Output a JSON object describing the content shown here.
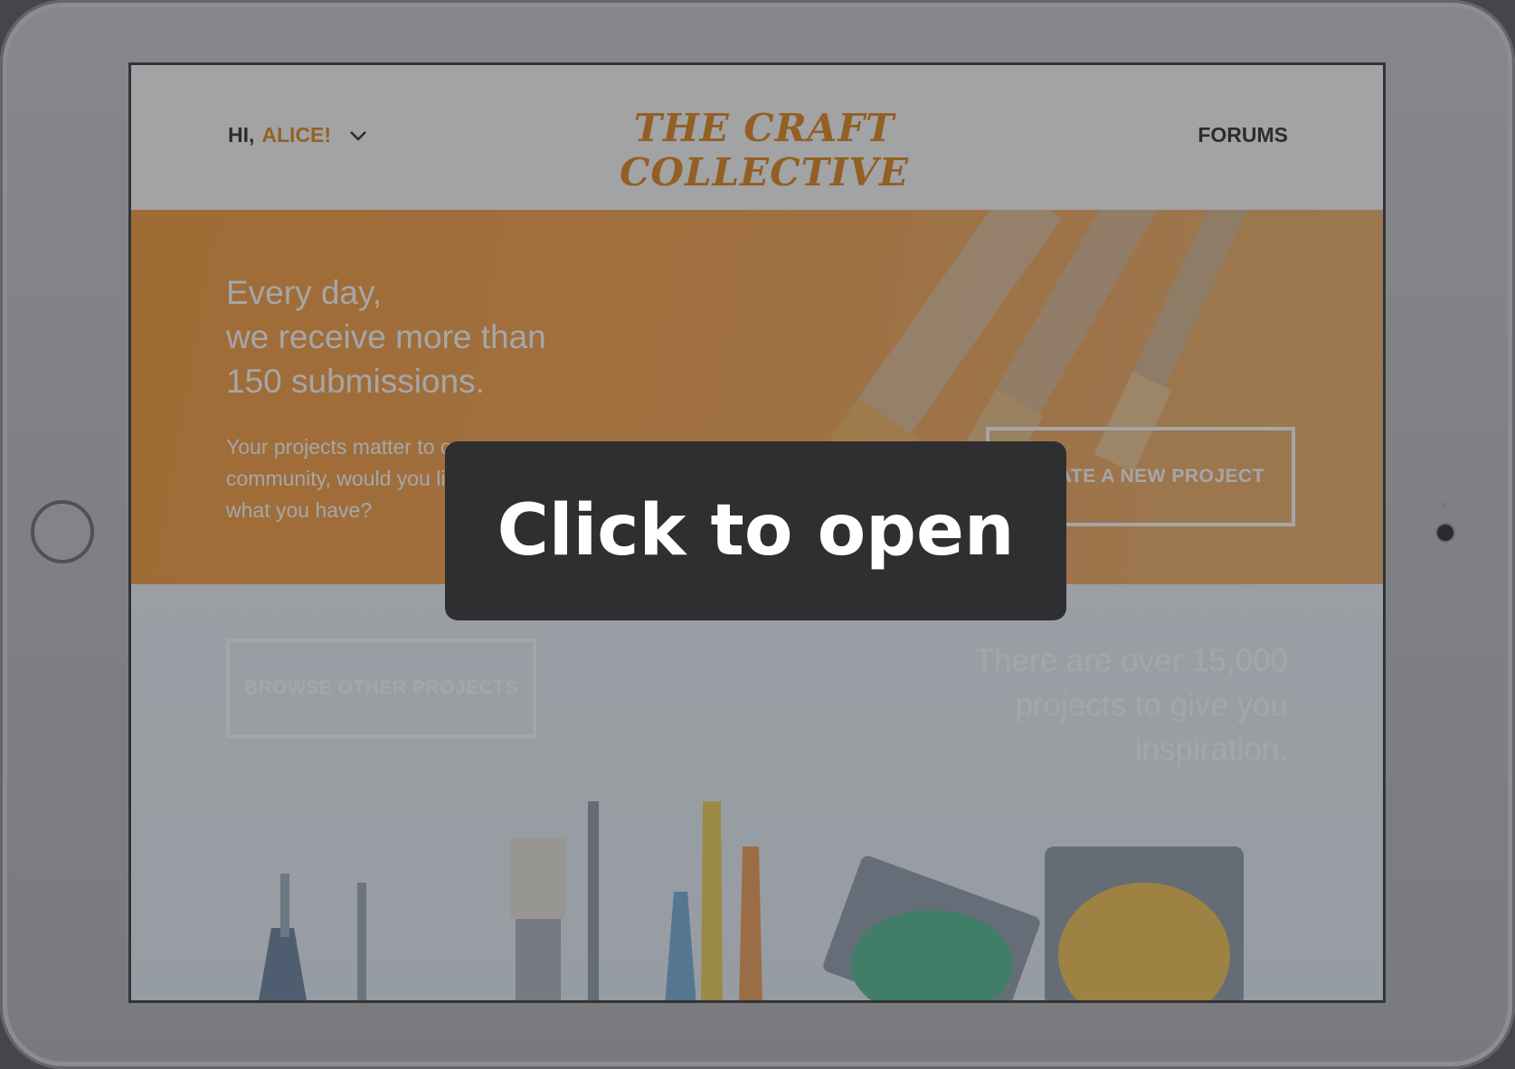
{
  "header": {
    "greeting_prefix": "HI,",
    "user_name": "ALICE!",
    "logo": "THE CRAFT COLLECTIVE",
    "forums_link": "FORUMS"
  },
  "hero": {
    "title_lines": [
      "Every day,",
      "we receive more than",
      "150 submissions."
    ],
    "text": "Your projects matter to our community, would you like to share what you have?",
    "create_button": "CREATE A NEW PROJECT"
  },
  "lower": {
    "browse_button": "BROWSE OTHER PROJECTS",
    "text": "There are over 15,000 projects to give you inspiration."
  },
  "overlay": {
    "label": "Click to open"
  },
  "colors": {
    "accent": "#e0861b",
    "hero_bg": "#f59a3a",
    "overlay_bg": "#2f2f31"
  }
}
